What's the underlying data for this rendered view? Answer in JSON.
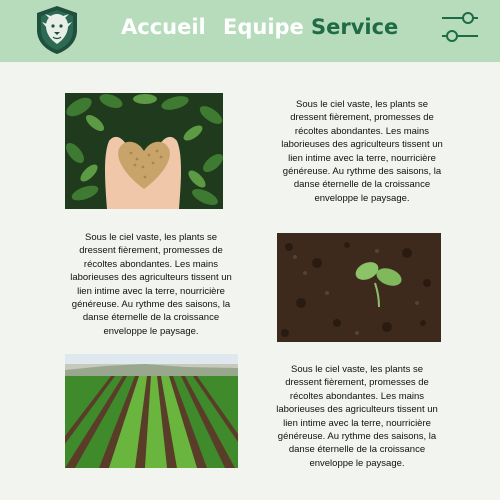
{
  "header": {
    "logo_icon": "lion-shield-icon",
    "nav": [
      {
        "label": "Accueil",
        "active": false
      },
      {
        "label": "Equipe",
        "active": false
      },
      {
        "label": "Service",
        "active": true
      }
    ],
    "menu_icon": "sliders-icon",
    "colors": {
      "header_bg": "#b7dcbc",
      "active": "#1f6b46",
      "inactive": "#ffffff",
      "page_bg": "#f2f4ef"
    }
  },
  "sections": [
    {
      "image": "hands-grain-heart-image",
      "text": "Sous le ciel vaste, les plants se dressent fièrement, promesses de récoltes abondantes. Les mains laborieuses des agriculteurs tissent un lien intime avec la terre, nourricière généreuse. Au rythme des saisons, la danse éternelle de la croissance enveloppe le paysage."
    },
    {
      "image": "seedling-soil-image",
      "text": "Sous le ciel vaste, les plants se dressent fièrement, promesses de récoltes abondantes. Les mains laborieuses des agriculteurs tissent un lien intime avec la terre, nourricière généreuse. Au rythme des saisons, la danse éternelle de la croissance enveloppe le paysage."
    },
    {
      "image": "crop-field-rows-image",
      "text": "Sous le ciel vaste, les plants se dressent fièrement, promesses de récoltes abondantes. Les mains laborieuses des agriculteurs tissent un lien intime avec la terre, nourricière généreuse. Au rythme des saisons, la danse éternelle de la croissance enveloppe le paysage."
    }
  ]
}
